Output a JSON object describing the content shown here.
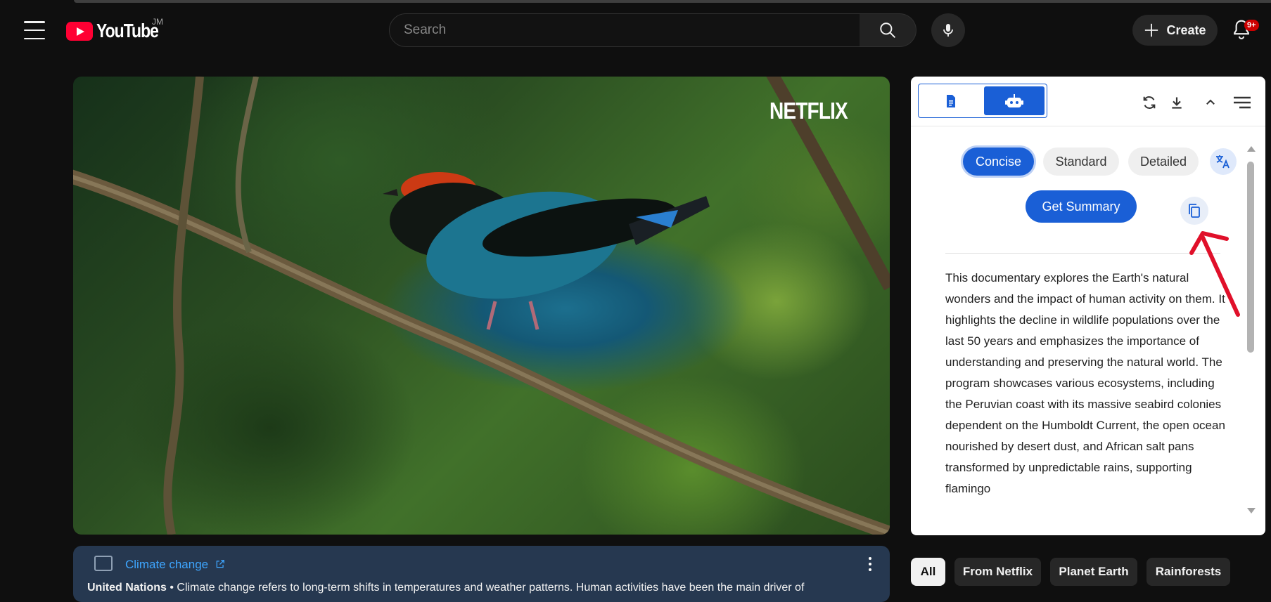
{
  "header": {
    "logo_text": "YouTube",
    "country_code": "JM",
    "search_placeholder": "Search",
    "create_label": "Create",
    "notification_count": "9+"
  },
  "video": {
    "watermark": "NETFLIX"
  },
  "info_panel": {
    "topic_link": "Climate change",
    "source": "United Nations",
    "separator": " • ",
    "description": "Climate change refers to long-term shifts in temperatures and weather patterns. Human activities have been the main driver of"
  },
  "summary_panel": {
    "modes": [
      "Concise",
      "Standard",
      "Detailed"
    ],
    "selected_mode": "Concise",
    "get_summary_label": "Get Summary",
    "summary_text": "This documentary explores the Earth's natural wonders and the impact of human activity on them. It highlights the decline in wildlife populations over the last 50 years and emphasizes the importance of understanding and preserving the natural world. The program showcases various ecosystems, including the Peruvian coast with its massive seabird colonies dependent on the Humboldt Current, the open ocean nourished by desert dust, and African salt pans transformed by unpredictable rains, supporting flamingo",
    "accent_color": "#1a5fd6"
  },
  "chips": [
    "All",
    "From Netflix",
    "Planet Earth",
    "Rainforests"
  ],
  "annotation": {
    "arrow_color": "#e0102a"
  }
}
